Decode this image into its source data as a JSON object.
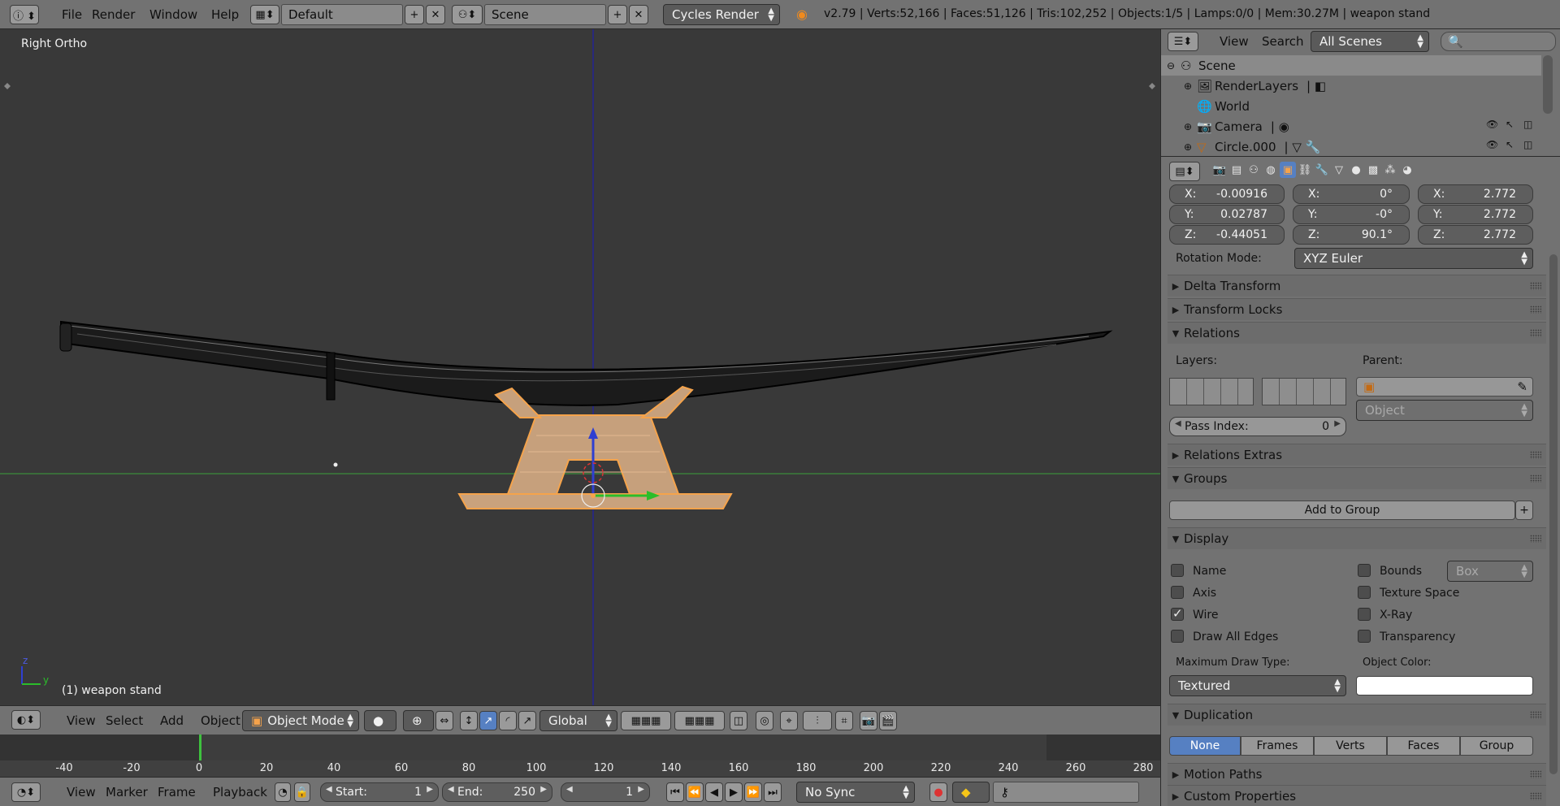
{
  "topbar": {
    "menus": [
      "File",
      "Render",
      "Window",
      "Help"
    ],
    "layout_name": "Default",
    "scene_name": "Scene",
    "render_engine": "Cycles Render",
    "stats": "v2.79 | Verts:52,166 | Faces:51,126 | Tris:102,252 | Objects:1/5 | Lamps:0/0 | Mem:30.27M | weapon stand"
  },
  "viewport": {
    "view_name": "Right Ortho",
    "object_label": "(1) weapon stand",
    "axis_z": "z",
    "axis_y": "y"
  },
  "viewport_header": {
    "menus": [
      "View",
      "Select",
      "Add",
      "Object"
    ],
    "mode": "Object Mode",
    "orientation": "Global"
  },
  "timeline": {
    "ticks": [
      "-40",
      "-20",
      "0",
      "20",
      "40",
      "60",
      "80",
      "100",
      "120",
      "140",
      "160",
      "180",
      "200",
      "220",
      "240",
      "260",
      "280"
    ],
    "current_frame": 1
  },
  "timeline_footer": {
    "menus": [
      "View",
      "Marker",
      "Frame",
      "Playback"
    ],
    "start_label": "Start:",
    "start_value": "1",
    "end_label": "End:",
    "end_value": "250",
    "current_value": "1",
    "sync": "No Sync"
  },
  "outliner": {
    "menus": [
      "View",
      "Search"
    ],
    "scenes_dropdown": "All Scenes",
    "items": [
      {
        "label": "Scene"
      },
      {
        "label": "RenderLayers"
      },
      {
        "label": "World"
      },
      {
        "label": "Camera"
      },
      {
        "label": "Circle.000"
      }
    ]
  },
  "properties": {
    "location": {
      "x": "-0.00916",
      "y": "0.02787",
      "z": "-0.44051"
    },
    "rotation": {
      "x": "0°",
      "y": "-0°",
      "z": "90.1°"
    },
    "scale": {
      "x": "2.772",
      "y": "2.772",
      "z": "2.772"
    },
    "axis_labels": {
      "x": "X:",
      "y": "Y:",
      "z": "Z:"
    },
    "rotation_mode_label": "Rotation Mode:",
    "rotation_mode": "XYZ Euler",
    "panels": {
      "delta_transform": "Delta Transform",
      "transform_locks": "Transform Locks",
      "relations": "Relations",
      "relations_extras": "Relations Extras",
      "groups": "Groups",
      "display": "Display",
      "duplication": "Duplication",
      "motion_paths": "Motion Paths",
      "custom_properties": "Custom Properties"
    },
    "relations": {
      "layers_label": "Layers:",
      "parent_label": "Parent:",
      "parent_type": "Object",
      "pass_index_label": "Pass Index:",
      "pass_index": "0"
    },
    "groups": {
      "add_button": "Add to Group"
    },
    "display": {
      "name": "Name",
      "axis": "Axis",
      "wire": "Wire",
      "draw_all_edges": "Draw All Edges",
      "bounds": "Bounds",
      "bounds_type": "Box",
      "texture_space": "Texture Space",
      "xray": "X-Ray",
      "transparency": "Transparency",
      "max_draw_type_label": "Maximum Draw Type:",
      "max_draw_type": "Textured",
      "object_color_label": "Object Color:",
      "wire_checked": true
    },
    "duplication": {
      "options": [
        "None",
        "Frames",
        "Verts",
        "Faces",
        "Group"
      ],
      "selected": "None"
    }
  },
  "colors": {
    "selection_orange": "#f5a34b",
    "active_blue": "#5680c2",
    "y_axis_green": "#3aa13a",
    "z_axis_blue": "#1f1fa8"
  }
}
